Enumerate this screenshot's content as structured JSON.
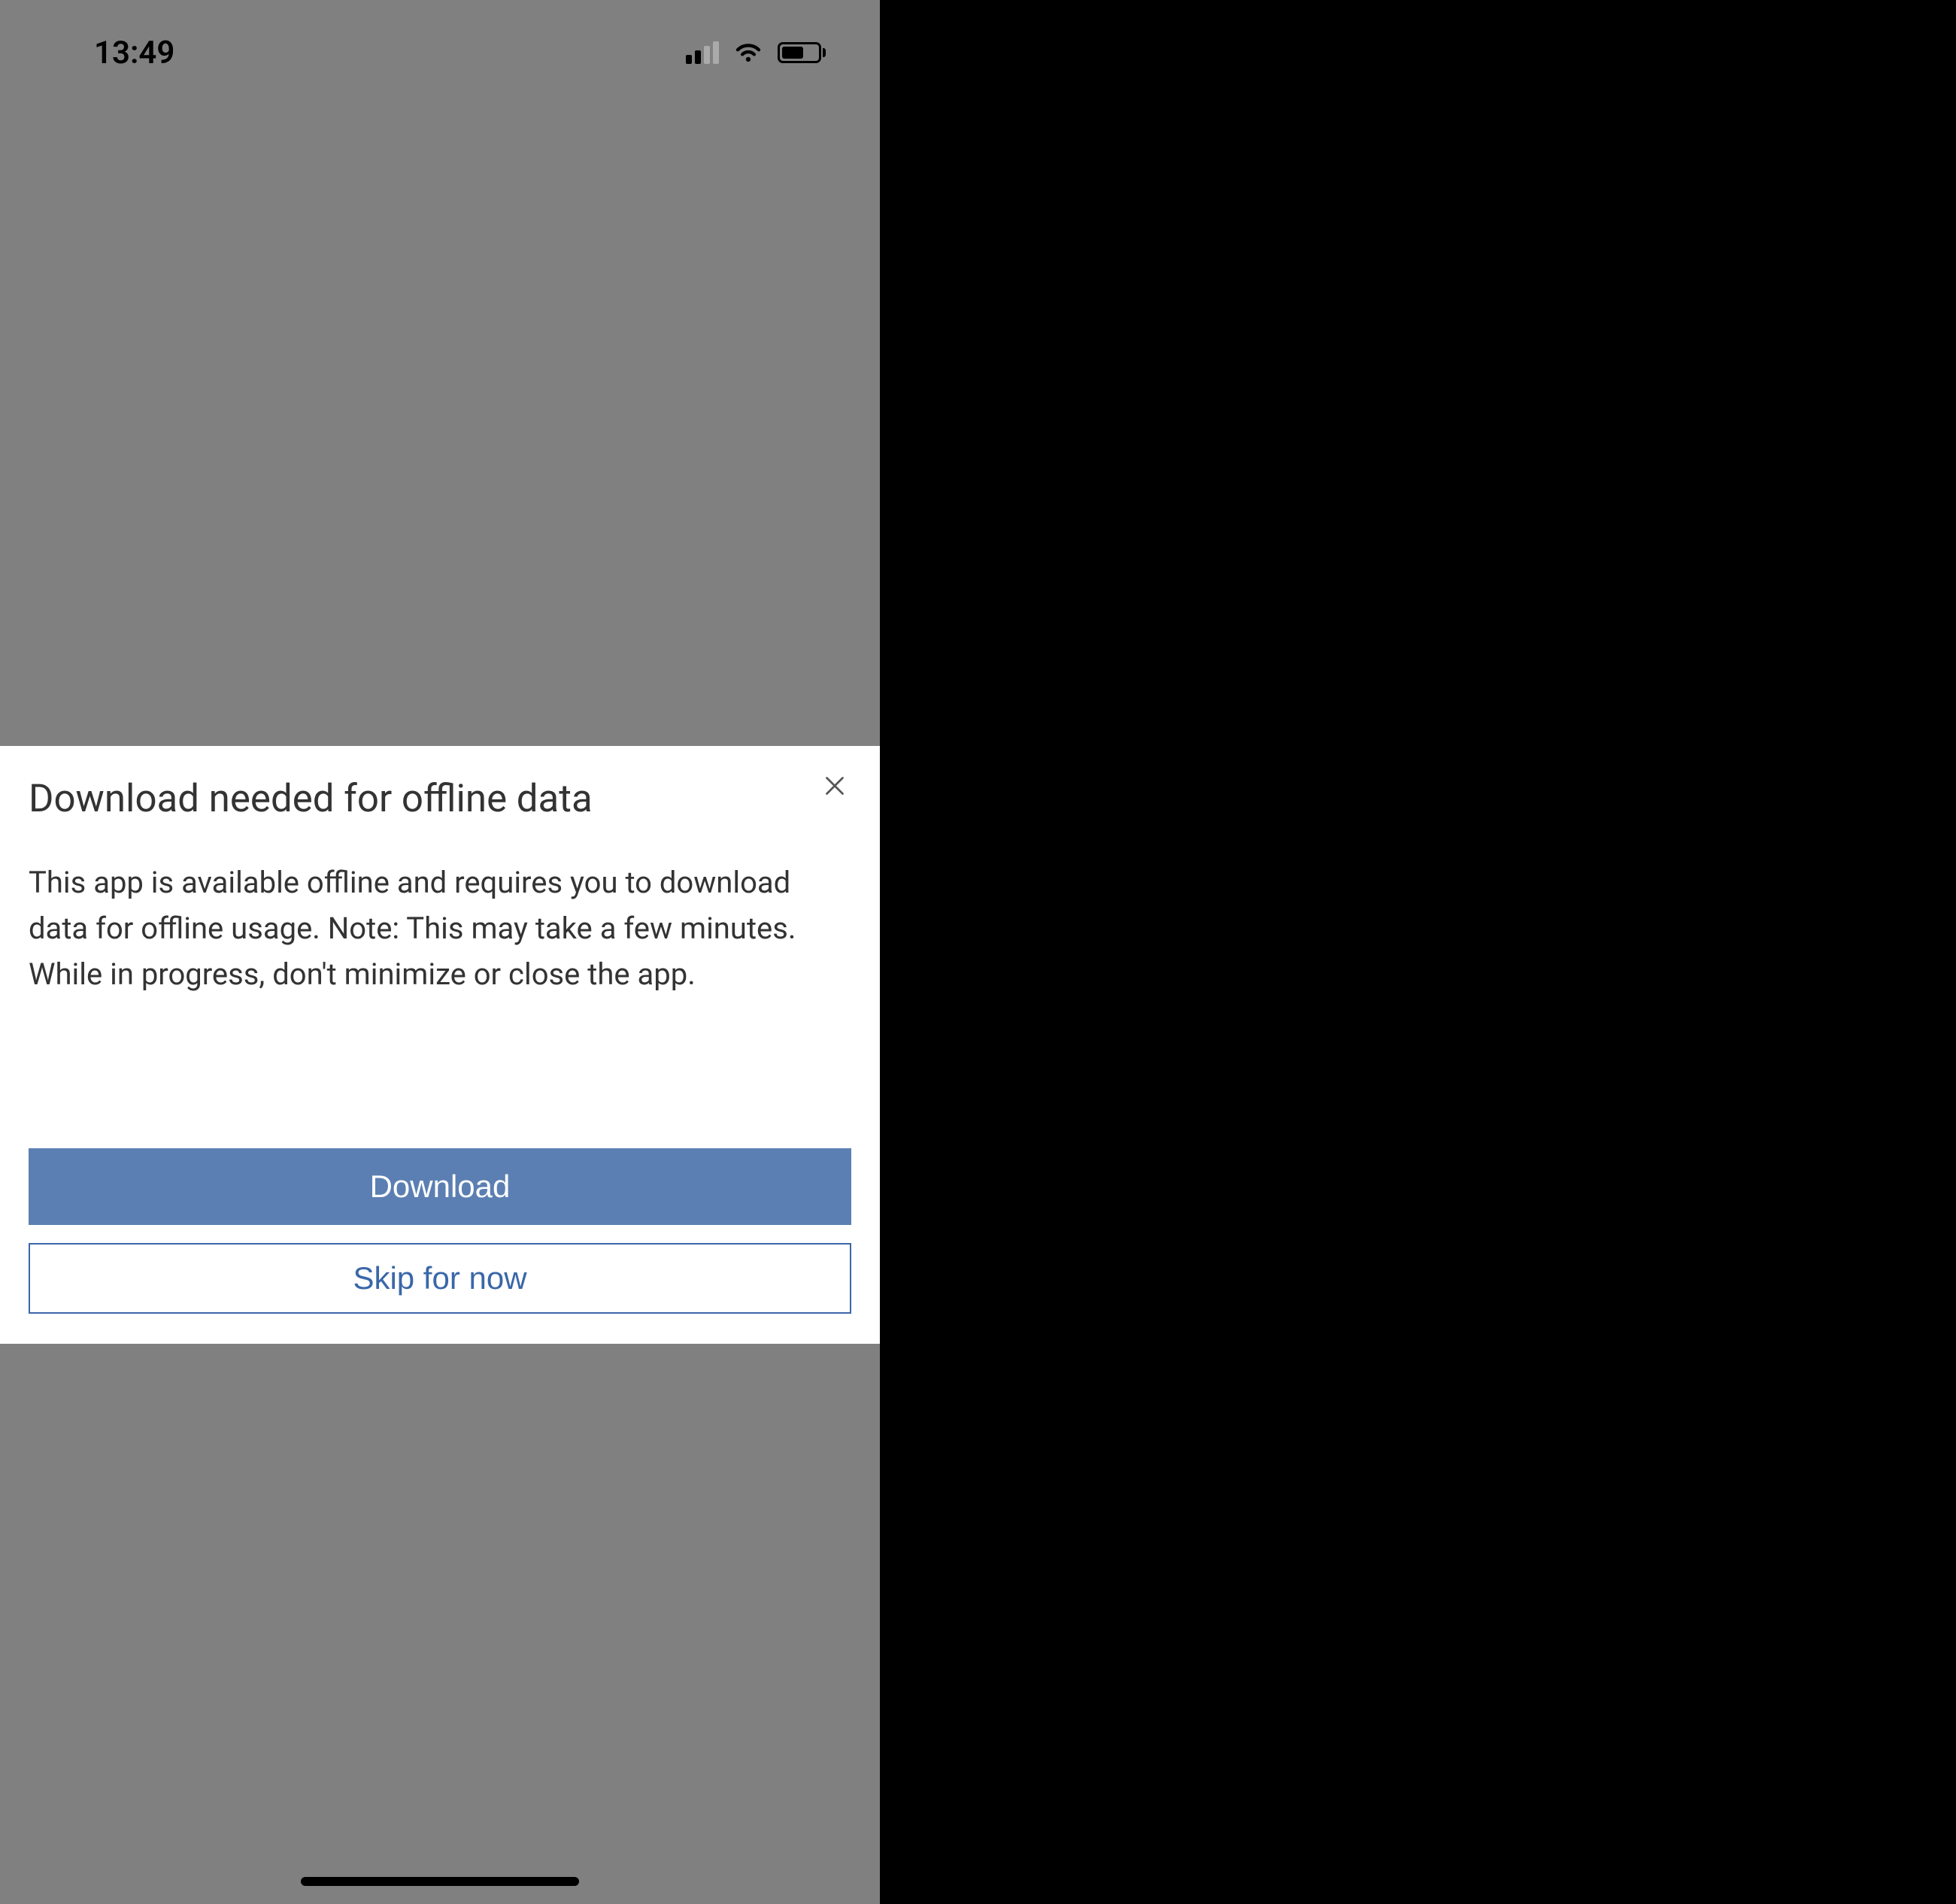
{
  "statusBar": {
    "time": "13:49"
  },
  "dialog": {
    "title": "Download needed for offline data",
    "body": "This app is available offline and requires you to download data for offline usage. Note: This may take a few minutes. While in progress, don't minimize or close the app.",
    "primaryLabel": "Download",
    "secondaryLabel": "Skip for now"
  }
}
